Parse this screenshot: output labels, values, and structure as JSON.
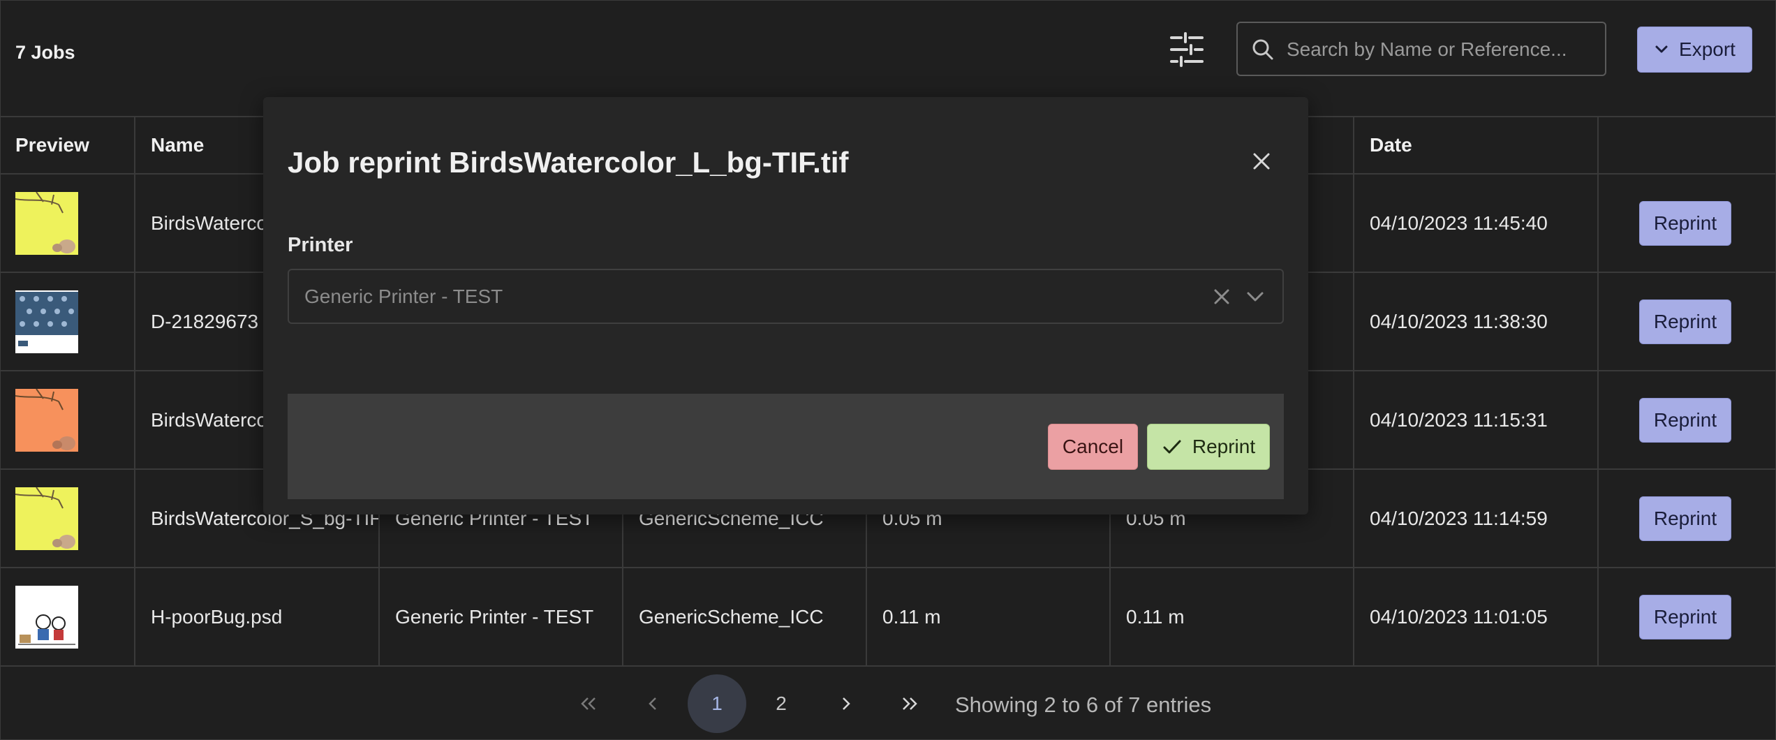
{
  "header": {
    "jobs_count": "7 Jobs",
    "search_placeholder": "Search by Name or Reference...",
    "export_label": "Export"
  },
  "table": {
    "columns": [
      "Preview",
      "Name",
      "",
      "",
      "",
      "",
      "Date",
      ""
    ],
    "rows": [
      {
        "name": "BirdsWatercolor_L_bg-TIF.tif",
        "printer": "",
        "scheme": "",
        "length1": "",
        "length2": "",
        "date": "04/10/2023 11:45:40",
        "action": "Reprint",
        "thumb": "yellow-birds"
      },
      {
        "name": "D-21829673",
        "printer": "",
        "scheme": "",
        "length1": "",
        "length2": "",
        "date": "04/10/2023 11:38:30",
        "action": "Reprint",
        "thumb": "blue-pattern"
      },
      {
        "name": "BirdsWatercolor",
        "printer": "",
        "scheme": "",
        "length1": "",
        "length2": "",
        "date": "04/10/2023 11:15:31",
        "action": "Reprint",
        "thumb": "orange-birds"
      },
      {
        "name": "BirdsWatercolor_S_bg-TIF.",
        "printer": "Generic Printer - TEST",
        "scheme": "GenericScheme_ICC",
        "length1": "0.05 m",
        "length2": "0.05 m",
        "date": "04/10/2023 11:14:59",
        "action": "Reprint",
        "thumb": "yellow-birds"
      },
      {
        "name": "H-poorBug.psd",
        "printer": "Generic Printer - TEST",
        "scheme": "GenericScheme_ICC",
        "length1": "0.11 m",
        "length2": "0.11 m",
        "date": "04/10/2023 11:01:05",
        "action": "Reprint",
        "thumb": "bugs"
      }
    ]
  },
  "pagination": {
    "first": "«",
    "prev": "‹",
    "pages": [
      "1",
      "2"
    ],
    "active_page": "1",
    "next": "›",
    "last": "»",
    "showing_text": "Showing 2 to 6 of 7 entries"
  },
  "modal": {
    "title": "Job reprint BirdsWatercolor_L_bg-TIF.tif",
    "field_label": "Printer",
    "printer_value": "Generic Printer - TEST",
    "cancel_label": "Cancel",
    "confirm_label": "Reprint"
  },
  "colors": {
    "background": "#1f1f1f",
    "accent": "#a7ade6",
    "cancel": "#eba0a3",
    "confirm": "#c5e4a6",
    "modal": "#262626"
  }
}
